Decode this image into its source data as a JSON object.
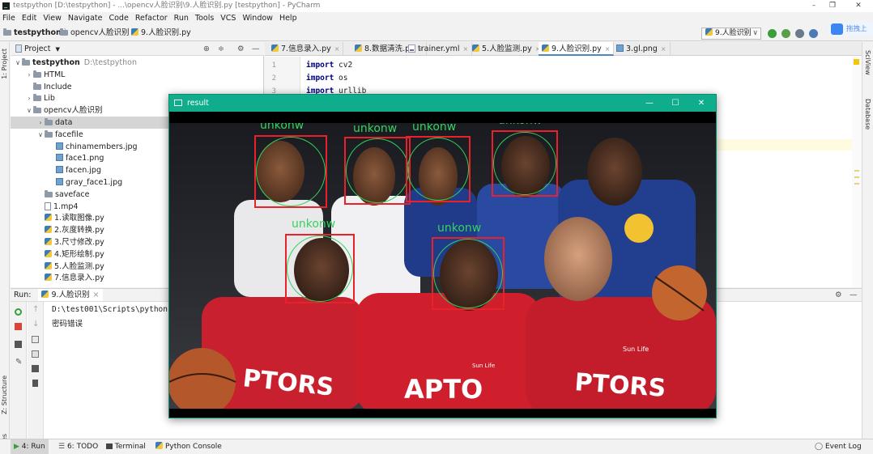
{
  "window": {
    "title": "testpython [D:\\testpython] - ...\\opencv人脸识别\\9.人脸识别.py [testpython] - PyCharm",
    "controls": [
      "–",
      "❐",
      "✕"
    ]
  },
  "menu": [
    "File",
    "Edit",
    "View",
    "Navigate",
    "Code",
    "Refactor",
    "Run",
    "Tools",
    "VCS",
    "Window",
    "Help"
  ],
  "breadcrumb": [
    "testpython",
    "opencv人脸识别",
    "9.人脸识别.py"
  ],
  "run_config": "9.人脸识别",
  "badge_text": "拖拽上",
  "project": {
    "title": "Project",
    "tree": [
      {
        "label": "testpython",
        "extra": "D:\\testpython",
        "depth": 0,
        "arrow": "∨",
        "kind": "folder",
        "bold": true
      },
      {
        "label": "HTML",
        "depth": 1,
        "arrow": "›",
        "kind": "folder"
      },
      {
        "label": "Include",
        "depth": 1,
        "arrow": "",
        "kind": "folder"
      },
      {
        "label": "Lib",
        "depth": 1,
        "arrow": "›",
        "kind": "folder"
      },
      {
        "label": "opencv人脸识别",
        "depth": 1,
        "arrow": "∨",
        "kind": "folder"
      },
      {
        "label": "data",
        "depth": 2,
        "arrow": "›",
        "kind": "folder",
        "selected": true
      },
      {
        "label": "facefile",
        "depth": 2,
        "arrow": "∨",
        "kind": "folder"
      },
      {
        "label": "chinamembers.jpg",
        "depth": 3,
        "arrow": "",
        "kind": "img"
      },
      {
        "label": "face1.png",
        "depth": 3,
        "arrow": "",
        "kind": "img"
      },
      {
        "label": "facen.jpg",
        "depth": 3,
        "arrow": "",
        "kind": "img"
      },
      {
        "label": "gray_face1.jpg",
        "depth": 3,
        "arrow": "",
        "kind": "img"
      },
      {
        "label": "saveface",
        "depth": 2,
        "arrow": "",
        "kind": "folder"
      },
      {
        "label": "1.mp4",
        "depth": 2,
        "arrow": "",
        "kind": "file"
      },
      {
        "label": "1.读取图像.py",
        "depth": 2,
        "arrow": "",
        "kind": "py"
      },
      {
        "label": "2.灰度转换.py",
        "depth": 2,
        "arrow": "",
        "kind": "py"
      },
      {
        "label": "3.尺寸修改.py",
        "depth": 2,
        "arrow": "",
        "kind": "py"
      },
      {
        "label": "4.矩形绘制.py",
        "depth": 2,
        "arrow": "",
        "kind": "py"
      },
      {
        "label": "5.人脸监测.py",
        "depth": 2,
        "arrow": "",
        "kind": "py"
      },
      {
        "label": "7.信息录入.py",
        "depth": 2,
        "arrow": "",
        "kind": "py"
      }
    ]
  },
  "tabs": [
    {
      "label": "7.信息录入.py",
      "kind": "py"
    },
    {
      "label": "8.数据清洗.py",
      "kind": "py"
    },
    {
      "label": "trainer.yml",
      "kind": "yml"
    },
    {
      "label": "5.人脸监测.py",
      "kind": "py"
    },
    {
      "label": "9.人脸识别.py",
      "kind": "py",
      "active": true
    },
    {
      "label": "3.gl.png",
      "kind": "img"
    }
  ],
  "editor": {
    "lines": [
      {
        "num": "1",
        "kw": "import",
        "rest": " cv2"
      },
      {
        "num": "2",
        "kw": "import",
        "rest": " os"
      },
      {
        "num": "3",
        "kw": "import",
        "rest": " urllib"
      }
    ]
  },
  "run": {
    "label": "Run:",
    "tab": "9.人脸识别",
    "console": [
      "D:\\test001\\Scripts\\python.",
      "密码错误"
    ]
  },
  "left_strip": [
    "1: Project",
    "Z: Structure",
    "2: Favorites"
  ],
  "right_strip": [
    "SciView",
    "Database"
  ],
  "statusbar": {
    "items": [
      "4: Run",
      "6: TODO",
      "Terminal",
      "Python Console"
    ],
    "right": "Event Log"
  },
  "result_window": {
    "title": "result",
    "faces": [
      {
        "label": "unkonw"
      },
      {
        "label": "unkonw"
      },
      {
        "label": "unkonw"
      },
      {
        "label": "unkonw"
      },
      {
        "label": "unkonw"
      },
      {
        "label": "unkonw"
      }
    ],
    "jersey_text": [
      "PTORS",
      "APTO",
      "PTORS"
    ],
    "patch_text": [
      "Sun Life",
      "Sun Life"
    ]
  },
  "colors": {
    "accent": "#10ad8c",
    "face_box": "#e8222b",
    "face_label": "#35d25f"
  }
}
